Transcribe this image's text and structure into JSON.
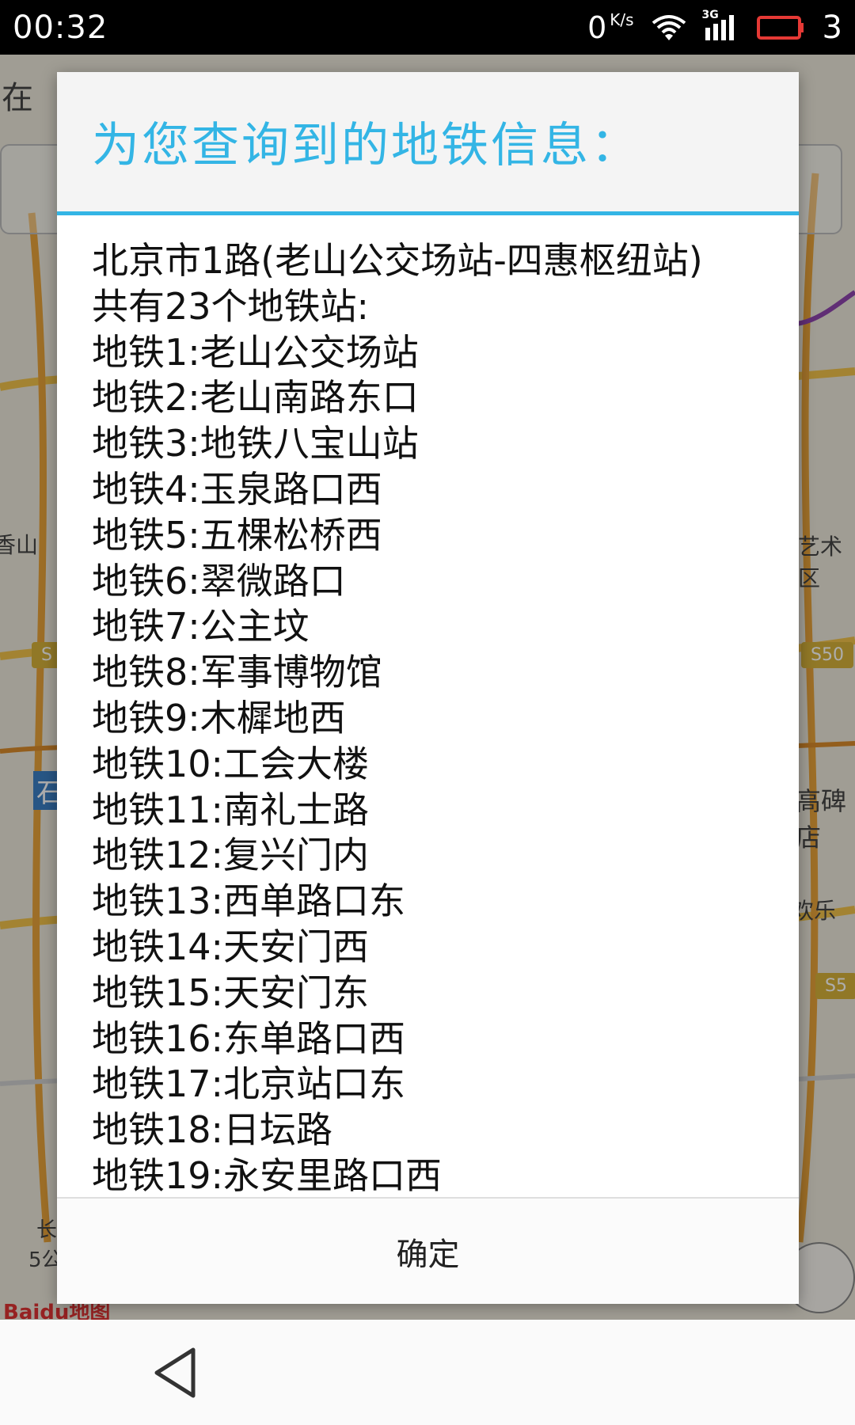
{
  "status_bar": {
    "time": "00:32",
    "net_speed": "0",
    "net_speed_unit": "K/s",
    "network_type": "3G",
    "battery": "3",
    "icons": [
      "wifi-icon",
      "signal-icon",
      "battery-icon"
    ],
    "battery_color": "#e53935"
  },
  "background_map": {
    "labels": [
      "在",
      "香山",
      "艺术区",
      "高碑店",
      "欢乐",
      "石",
      "长",
      "5公"
    ],
    "badges": [
      "S50",
      "S5",
      "S"
    ],
    "logo": "Baidu地图"
  },
  "dialog": {
    "title": "为您查询到的地铁信息：",
    "accent_color": "#33b5e5",
    "lines": [
      "北京市1路(老山公交场站-四惠枢纽站)",
      "共有23个地铁站:",
      "地铁1:老山公交场站",
      "地铁2:老山南路东口",
      "地铁3:地铁八宝山站",
      "地铁4:玉泉路口西",
      "地铁5:五棵松桥西",
      "地铁6:翠微路口",
      "地铁7:公主坟",
      "地铁8:军事博物馆",
      "地铁9:木樨地西",
      "地铁10:工会大楼",
      "地铁11:南礼士路",
      "地铁12:复兴门内",
      "地铁13:西单路口东",
      "地铁14:天安门西",
      "地铁15:天安门东",
      "地铁16:东单路口西",
      "地铁17:北京站口东",
      "地铁18:日坛路",
      "地铁19:永安里路口西"
    ],
    "ok_label": "确定"
  },
  "nav_bar": {
    "back_icon": "back-triangle-icon"
  }
}
